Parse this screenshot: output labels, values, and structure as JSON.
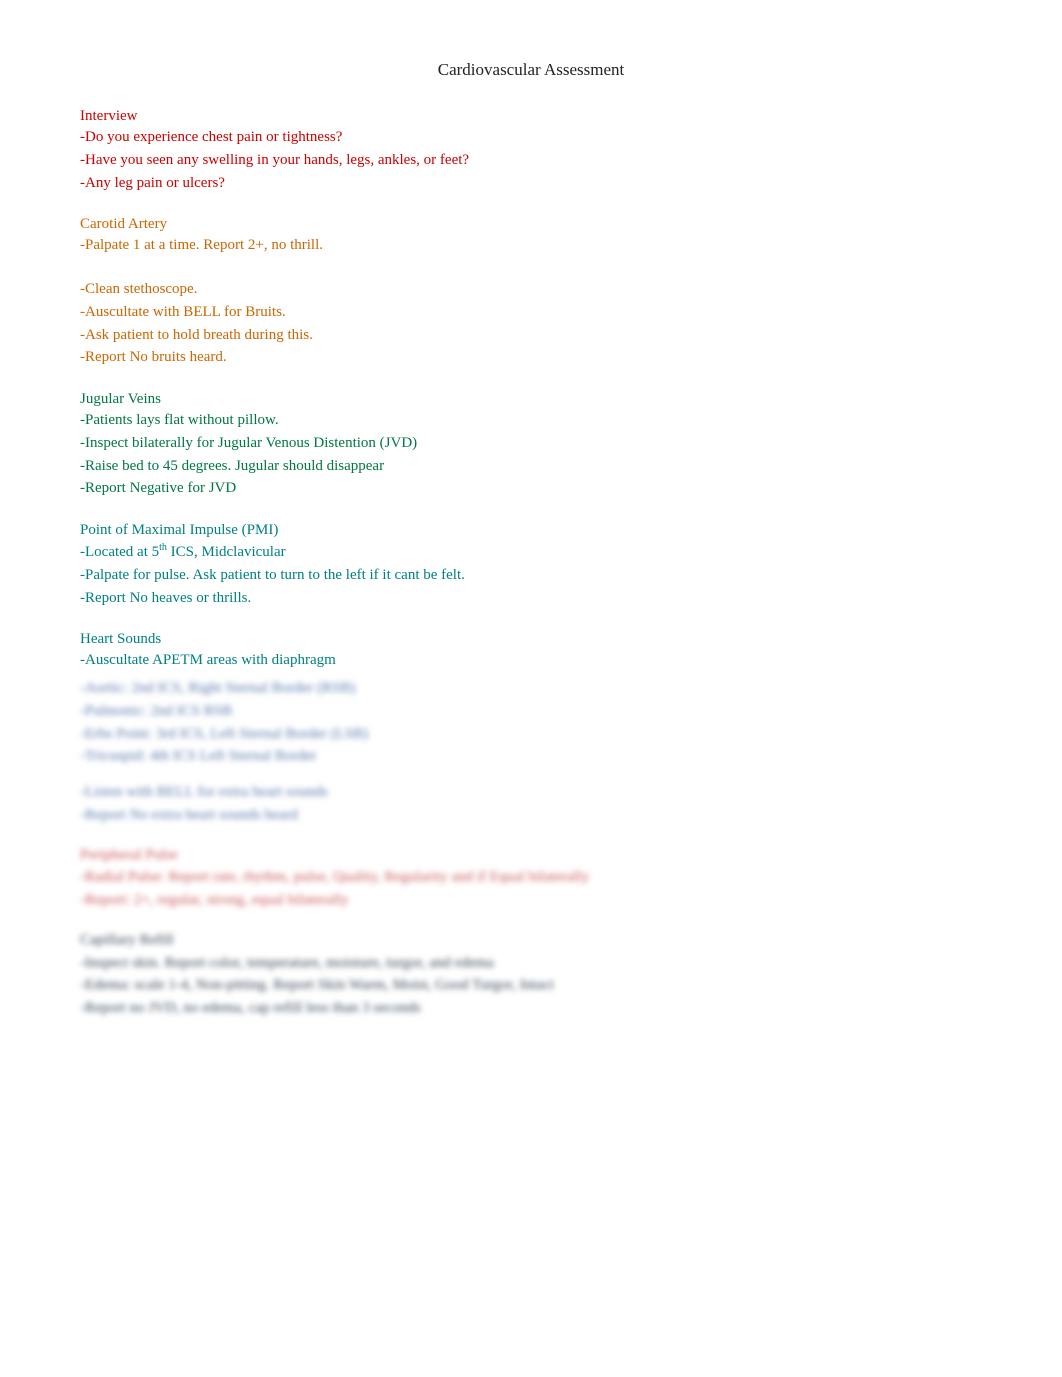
{
  "page": {
    "title": "Cardiovascular Assessment"
  },
  "sections": {
    "interview": {
      "heading": "Interview",
      "lines": [
        "-Do you experience chest pain or tightness?",
        "-Have you seen any swelling in your hands, legs, ankles, or feet?",
        "-Any leg pain or ulcers?"
      ]
    },
    "carotid": {
      "heading": "Carotid Artery",
      "lines": [
        "-Palpate 1 at a time. Report 2+, no thrill."
      ],
      "lines2": [
        "-Clean stethoscope.",
        "-Auscultate with BELL for Bruits.",
        "-Ask patient to hold breath during this.",
        "-Report No bruits heard."
      ]
    },
    "jugular": {
      "heading": "Jugular Veins",
      "lines": [
        "-Patients lays flat without pillow.",
        "-Inspect bilaterally for Jugular Venous Distention (JVD)",
        "-Raise bed to 45 degrees. Jugular should disappear",
        "-Report Negative for JVD"
      ]
    },
    "pmi": {
      "heading": "Point of Maximal Impulse (PMI)",
      "lines": [
        "-Located at 5th ICS, Midclavicular",
        "-Palpate for pulse. Ask patient to turn to the left if it cant be felt.",
        "-Report No heaves or thrills."
      ]
    },
    "heart_sounds": {
      "heading": "Heart Sounds",
      "lines": [
        "-Auscultate APETM areas with diaphragm"
      ],
      "blurred_lines_1": [
        "-Aortic: 2nd ICS, Right Sternal Border (RSB)",
        "-Pulmonic: 2nd ICS RSB",
        "-Erbs Point: 3rd ICS, Left Sternal Border (LSB)",
        "-Tricuspid: 4th ICS Left Sternal Border"
      ],
      "blurred_lines_2": [
        "-Listen with BELL for extra heart sounds",
        "-Report No extra heart sounds heard"
      ],
      "blurred_section_3_heading": "Peripheral Pulse",
      "blurred_lines_3": [
        "-Radial Pulse: Report rate, rhythm, pulse, Quality, Regularity and if Equal bilaterally",
        "-Report: 2+, regular, strong, equal bilaterally"
      ],
      "blurred_section_4_heading": "Capillary Refill",
      "blurred_lines_4": [
        "-Inspect skin. Report color, temperature, moisture, turgor, and edema",
        "-Edema: scale 1-4, Non-pitting. Report Skin Warm, Moist, Good Turgor, Intact",
        "-Report no JVD, no edema, cap refill less than 3 seconds"
      ]
    }
  }
}
